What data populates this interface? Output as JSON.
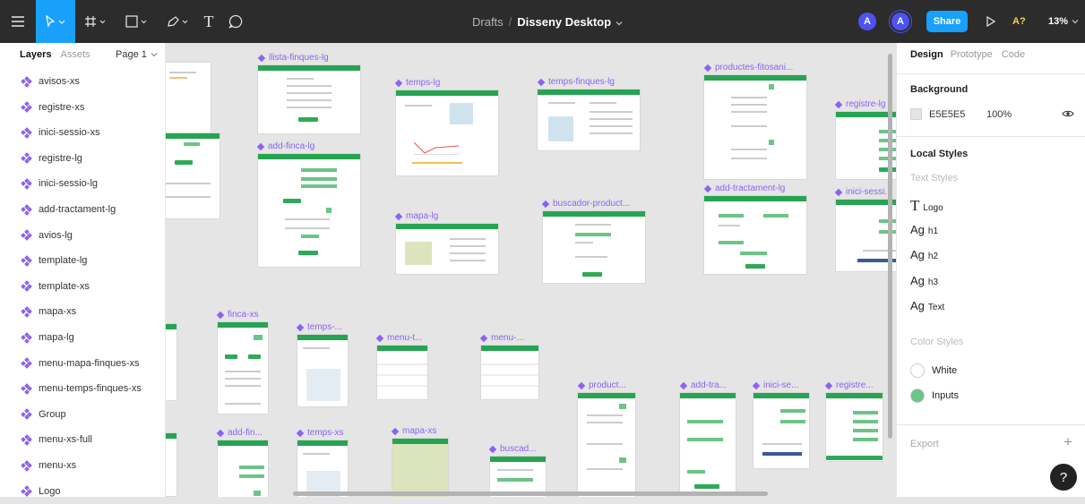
{
  "topbar": {
    "breadcrumb_prefix": "Drafts",
    "breadcrumb_sep": "/",
    "file_name": "Disseny Desktop",
    "share_label": "Share",
    "user_initial": "A",
    "a11y_label": "A?",
    "zoom": "13%"
  },
  "left_panel": {
    "tab_layers": "Layers",
    "tab_assets": "Assets",
    "page_selector": "Page 1",
    "layers": [
      "avisos-xs",
      "registre-xs",
      "inici-sessio-xs",
      "registre-lg",
      "inici-sessio-lg",
      "add-tractament-lg",
      "avios-lg",
      "template-lg",
      "template-xs",
      "mapa-xs",
      "mapa-lg",
      "menu-mapa-finques-xs",
      "menu-temps-finques-xs",
      "Group",
      "menu-xs-full",
      "menu-xs",
      "Logo"
    ]
  },
  "frames": [
    "llista-finques-lg",
    "temps-lg",
    "temps-finques-lg",
    "productes-fitosani...",
    "registre-lg",
    "add-finca-lg",
    "mapa-lg",
    "buscador-product...",
    "add-tractament-lg",
    "inici-sessi...",
    "finca-xs",
    "temps-...",
    "menu-t...",
    "menu-...",
    "product...",
    "add-tra...",
    "inici-se...",
    "registre...",
    "add-fin...",
    "temps-xs",
    "mapa-xs",
    "buscad..."
  ],
  "right_panel": {
    "tab_design": "Design",
    "tab_prototype": "Prototype",
    "tab_code": "Code",
    "background_title": "Background",
    "bg_hex": "E5E5E5",
    "bg_opacity": "100%",
    "local_styles_title": "Local Styles",
    "text_styles_title": "Text Styles",
    "text_styles": [
      {
        "prefix": "T",
        "name": "Logo"
      },
      {
        "prefix": "Ag",
        "name": "h1"
      },
      {
        "prefix": "Ag",
        "name": "h2"
      },
      {
        "prefix": "Ag",
        "name": "h3"
      },
      {
        "prefix": "Ag",
        "name": "Text"
      }
    ],
    "color_styles_title": "Color Styles",
    "color_styles": [
      {
        "name": "White",
        "color": "#ffffff"
      },
      {
        "name": "Inputs",
        "color": "#6cc487"
      }
    ],
    "export_title": "Export",
    "export_add": "+",
    "help": "?"
  },
  "colors": {
    "topbar": "#2c2c2c",
    "share": "#18a0fb",
    "accent": "#8b63f2",
    "frame_header": "#27a452",
    "avatar": "#4d52f0",
    "a11y": "#f6d54c"
  }
}
